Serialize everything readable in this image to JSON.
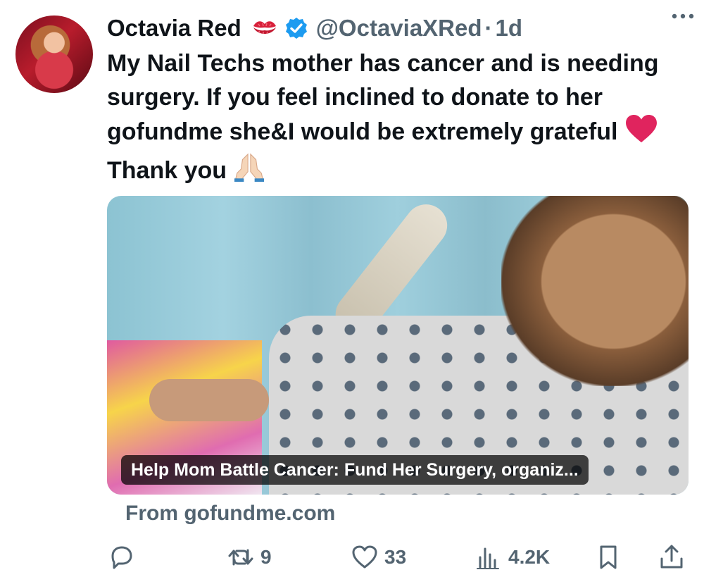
{
  "tweet": {
    "author_name": "Octavia Red",
    "handle": "@OctaviaXRed",
    "separator": "·",
    "time": "1d",
    "text_main": "My Nail Techs mother has cancer and is needing surgery. If you feel inclined to donate to her gofundme she&I would be extremely grateful",
    "text_thanks": "Thank you",
    "emojis": [
      "kiss-mark",
      "verified-badge",
      "red-heart",
      "folded-hands"
    ]
  },
  "card": {
    "title": "Help Mom Battle Cancer: Fund Her Surgery, organiz...",
    "source": "From gofundme.com"
  },
  "actions": {
    "reply": {
      "icon": "reply-icon",
      "count": ""
    },
    "retweet": {
      "icon": "retweet-icon",
      "count": "9"
    },
    "like": {
      "icon": "heart-icon",
      "count": "33"
    },
    "views": {
      "icon": "views-icon",
      "count": "4.2K"
    },
    "bookmark": {
      "icon": "bookmark-icon"
    },
    "share": {
      "icon": "share-icon"
    }
  },
  "colors": {
    "text": "#0f1419",
    "secondary": "#536471",
    "verified": "#1d9bf0",
    "heart_emoji": "#e0245e"
  }
}
